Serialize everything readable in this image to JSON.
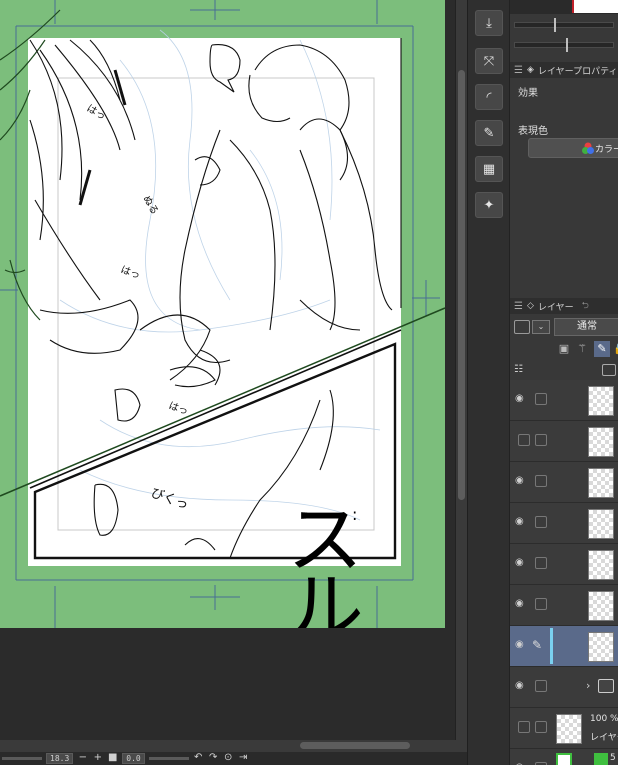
{
  "status_bar": {
    "zoom_value": "18.3",
    "minus_label": "−",
    "plus_label": "+",
    "angle_value": "0.0"
  },
  "manga": {
    "sfx_main": "スル",
    "sfx_main_dots": ":",
    "sfx_bidzu": "びくっ",
    "sfx_ha_1": "はっ",
    "sfx_ha_2": "はっ",
    "sfx_ha_3": "はっ",
    "sfx_nuru": "ぬる"
  },
  "tool_strip": {
    "tools": [
      {
        "icon": "download-icon"
      },
      {
        "icon": "transform-icon"
      },
      {
        "icon": "curve-icon"
      },
      {
        "icon": "edit-box-icon"
      },
      {
        "icon": "grid-icon"
      },
      {
        "icon": "figure-icon"
      }
    ]
  },
  "panels": {
    "layer_property_tab": "レイヤープロパティ",
    "effect_label": "効果",
    "expression_color_label": "表現色",
    "color_button_label": "カラー",
    "layer_tab": "レイヤー",
    "blend_mode": "通常",
    "bottom_layer_percent": "100 %",
    "bottom_layer_name": "レイヤー",
    "last_row_label": "5"
  },
  "colors": {
    "canvas_green": "#7cbe7c",
    "selected_layer": "#5a6a8a",
    "selected_strip": "#7ad0f0",
    "accent_red": "#c0202a"
  }
}
